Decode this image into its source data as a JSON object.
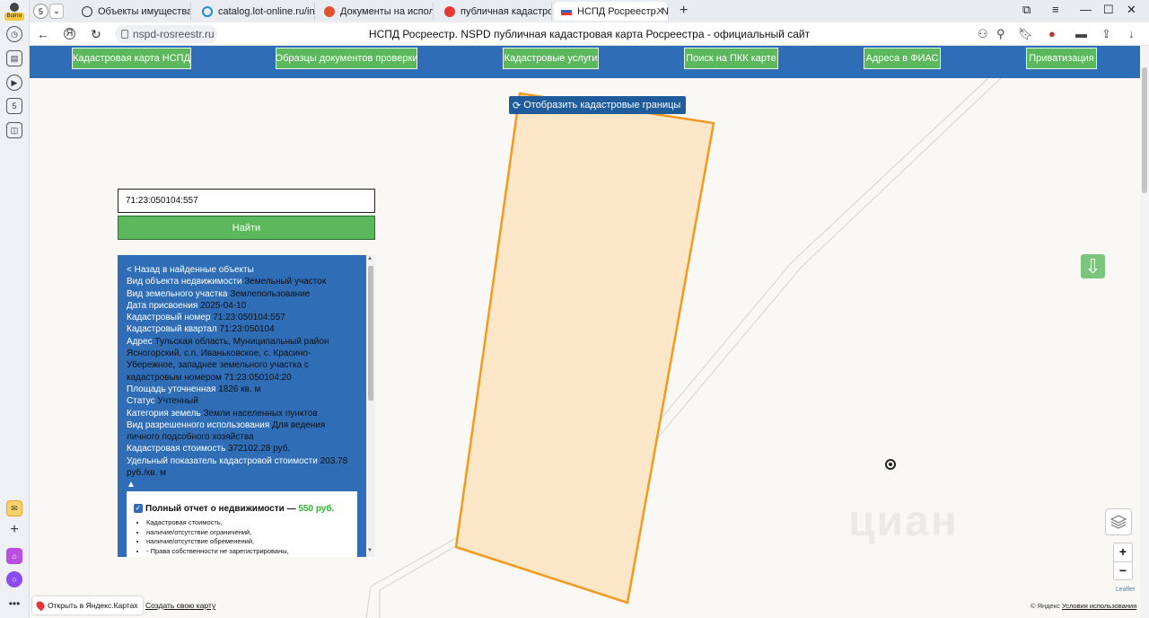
{
  "browser": {
    "profile_label": "Войти",
    "tab_count": "5",
    "tabs": [
      {
        "title": "Объекты имущества - ф",
        "color": "#333333"
      },
      {
        "title": "catalog.lot-online.ru/inde",
        "color": "#1a8cd8"
      },
      {
        "title": "Документы на исполнен",
        "color": "#e0542d"
      },
      {
        "title": "публичная кадастровая",
        "color": "#e53935"
      },
      {
        "title": "НСПД Росреестр. NSPD",
        "color": "#3a66c4"
      }
    ],
    "url": "nspd-rosreestr.ru",
    "page_title": "НСПД Росреестр. NSPD публичная кадастровая карта Росреестра - официальный сайт"
  },
  "sidebar_icons": [
    "history-icon",
    "collections-icon",
    "play-icon",
    "tab-count-icon",
    "screenshot-icon",
    "mail-icon",
    "add-icon",
    "app-icon",
    "alice-icon",
    "more-icon"
  ],
  "nav": {
    "buttons": [
      "Кадастровая карта НСПД",
      "Образцы документов проверки",
      "Кадастровые услуги",
      "Поиск на ПКК карте",
      "Адреса в ФИАС",
      "Приватизация"
    ]
  },
  "map": {
    "cad_button": "Отобразить кадастровые границы",
    "search_value": "71:23:050104:557",
    "find_button": "Найти",
    "info": {
      "back_link": "< Назад в найденные объекты",
      "fields": [
        {
          "label": "Вид объекта недвижимости",
          "value": "Земельный участок"
        },
        {
          "label": "Вид земельного участка",
          "value": "Землепользование"
        },
        {
          "label": "Дата присвоения",
          "value": "2025-04-10"
        },
        {
          "label": "Кадастровый номер",
          "value": "71:23:050104:557"
        },
        {
          "label": "Кадастровый квартал",
          "value": "71:23:050104"
        },
        {
          "label": "Адрес",
          "value": "Тульская область, Муниципальный район Ясногорский, с.п. Иваньковское, с. Красино-Убережное, западнее земельного участка с кадастровым номером 71:23:050104:20"
        },
        {
          "label": "Площадь уточненная",
          "value": "1826 кв. м"
        },
        {
          "label": "Статус",
          "value": "Учтенный"
        },
        {
          "label": "Категория земель",
          "value": "Земли населенных пунктов"
        },
        {
          "label": "Вид разрешенного использования",
          "value": "Для ведения личного подсобного хозяйства"
        },
        {
          "label": "Кадастровая стоимость",
          "value": "372102.28 руб."
        },
        {
          "label": "Удельный показатель кадастровой стоимости",
          "value": "203.78 руб./кв. м"
        }
      ],
      "collapse": "▲"
    },
    "report": {
      "title": "Полный отчет о недвижимости —",
      "price": "550 руб.",
      "items": [
        "Кадастровая стоимость,",
        "наличие/отсутствие ограничений,",
        "наличие/отсутствие обременений,",
        "- Права собственности не зарегистрированы,"
      ]
    },
    "yandex_open": "Открыть в Яндекс.Картах",
    "create_map": "Создать свою карту",
    "copyright_prefix": "© Яндекс",
    "copyright_link": "Условия использования",
    "leaflet": "Leaflet",
    "watermark": "циан",
    "zoom_in": "+",
    "zoom_out": "−",
    "parcel_fill": "#fde7c9",
    "parcel_stroke": "#f39a1e"
  }
}
